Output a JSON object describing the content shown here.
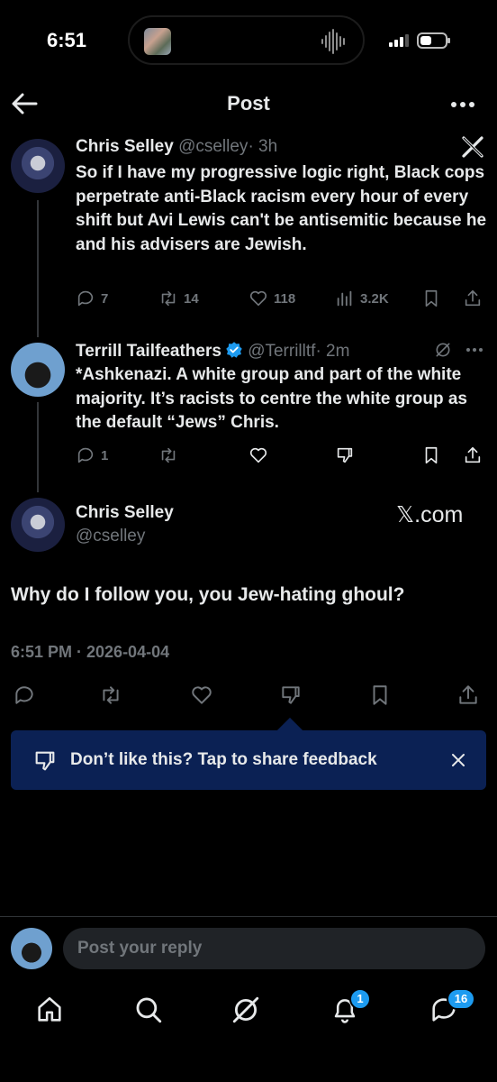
{
  "status_bar": {
    "time": "6:51"
  },
  "header": {
    "title": "Post"
  },
  "tweets": [
    {
      "name": "Chris Selley",
      "handle": "@cselley",
      "time": "· 3h",
      "text": "So if I have my progressive logic right, Black cops perpetrate anti-Black racism every hour of every shift but Avi Lewis can't be antisemitic because he and his advisers are Jewish.",
      "replies": "7",
      "reposts": "14",
      "likes": "118",
      "views": "3.2K"
    },
    {
      "name": "Terrill Tailfeathers",
      "handle": "@Terrilltf",
      "time": "· 2m",
      "text": "*Ashkenazi. A white group and part of the white majority. It’s racists to centre the white group as the default “Jews” Chris.",
      "replies": "1"
    }
  ],
  "main_post": {
    "name": "Chris Selley",
    "handle": "@cselley",
    "watermark": "𝕏.com",
    "text": "Why do I follow you, you Jew-hating ghoul?",
    "timestamp": "6:51 PM · 2026-04-04"
  },
  "feedback_banner": {
    "text": "Don’t like this? Tap to share feedback"
  },
  "reply": {
    "placeholder": "Post your reply"
  },
  "bottom_nav": {
    "notifications_badge": "1",
    "messages_badge": "16"
  },
  "colors": {
    "background": "#000000",
    "accent": "#1d9bf0",
    "banner": "#0b2154",
    "muted": "#71767b"
  }
}
